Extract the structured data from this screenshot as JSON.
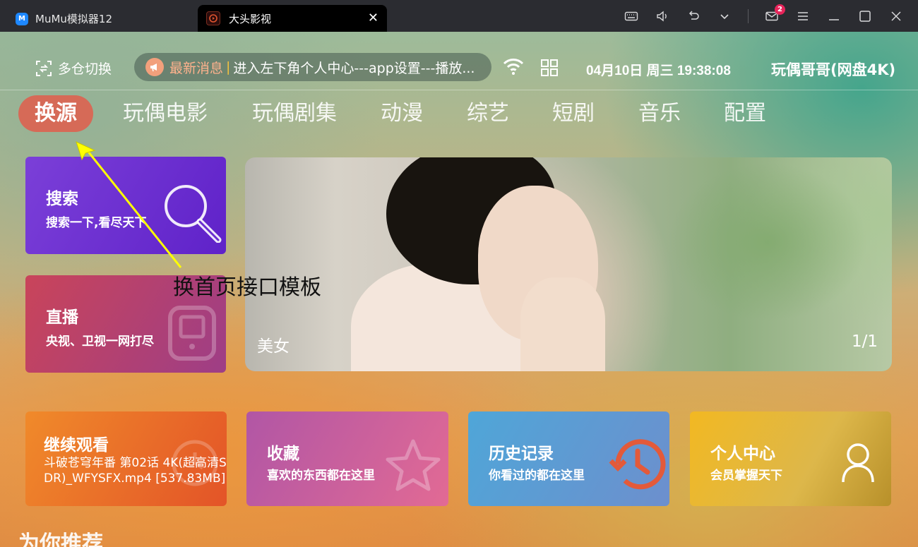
{
  "titlebar": {
    "emulator_title": "MuMu模拟器12",
    "emulator_logo": "M",
    "active_tab": "大头影视",
    "mail_count": "2"
  },
  "status": {
    "warehouse_label": "多仓切换",
    "news_label": "最新消息",
    "news_separator": "|",
    "news_message": "进入左下角个人中心---app设置---播放...",
    "datetime": "04月10日 周三 19:38:08",
    "username": "玩偶哥哥(网盘4K)"
  },
  "categories": [
    {
      "label": "换源",
      "active": true
    },
    {
      "label": "玩偶电影",
      "active": false
    },
    {
      "label": "玩偶剧集",
      "active": false
    },
    {
      "label": "动漫",
      "active": false
    },
    {
      "label": "综艺",
      "active": false
    },
    {
      "label": "短剧",
      "active": false
    },
    {
      "label": "音乐",
      "active": false
    },
    {
      "label": "配置",
      "active": false
    }
  ],
  "cards": {
    "search": {
      "title": "搜索",
      "subtitle": "搜索一下,看尽天下"
    },
    "live": {
      "title": "直播",
      "subtitle": "央视、卫视一网打尽"
    },
    "continue": {
      "title": "继续观看",
      "file": "斗破苍穹年番 第02话 4K(超高清SDR)_WFYSFX.mp4 [537.83MB]"
    },
    "favorites": {
      "title": "收藏",
      "subtitle": "喜欢的东西都在这里"
    },
    "history": {
      "title": "历史记录",
      "subtitle": "你看过的都在这里"
    },
    "profile": {
      "title": "个人中心",
      "subtitle": "会员掌握天下"
    }
  },
  "banner": {
    "label": "美女",
    "pager": "1/1"
  },
  "recommend_title": "为你推荐",
  "annotation": {
    "text": "换首页接口模板",
    "arrow_color": "#ffff00"
  },
  "colors": {
    "active_tab_bg": "#d66a57",
    "badge": "#e6245a",
    "search_card": "#6f30d0",
    "live_card": "#b84070",
    "continue_card": "#ea6f29",
    "favorites_card": "#c860a0",
    "history_card": "#5e9ad2",
    "profile_card": "#e0b232"
  },
  "icons": {
    "warehouse": "scan-switch-icon",
    "news": "megaphone-icon",
    "network": "wifi-icon",
    "apps": "grid-icon",
    "search": "magnifier-icon",
    "live": "tablet-icon",
    "continue": "play-circle-icon",
    "favorites": "star-icon",
    "history": "history-clock-icon",
    "profile": "user-icon"
  }
}
